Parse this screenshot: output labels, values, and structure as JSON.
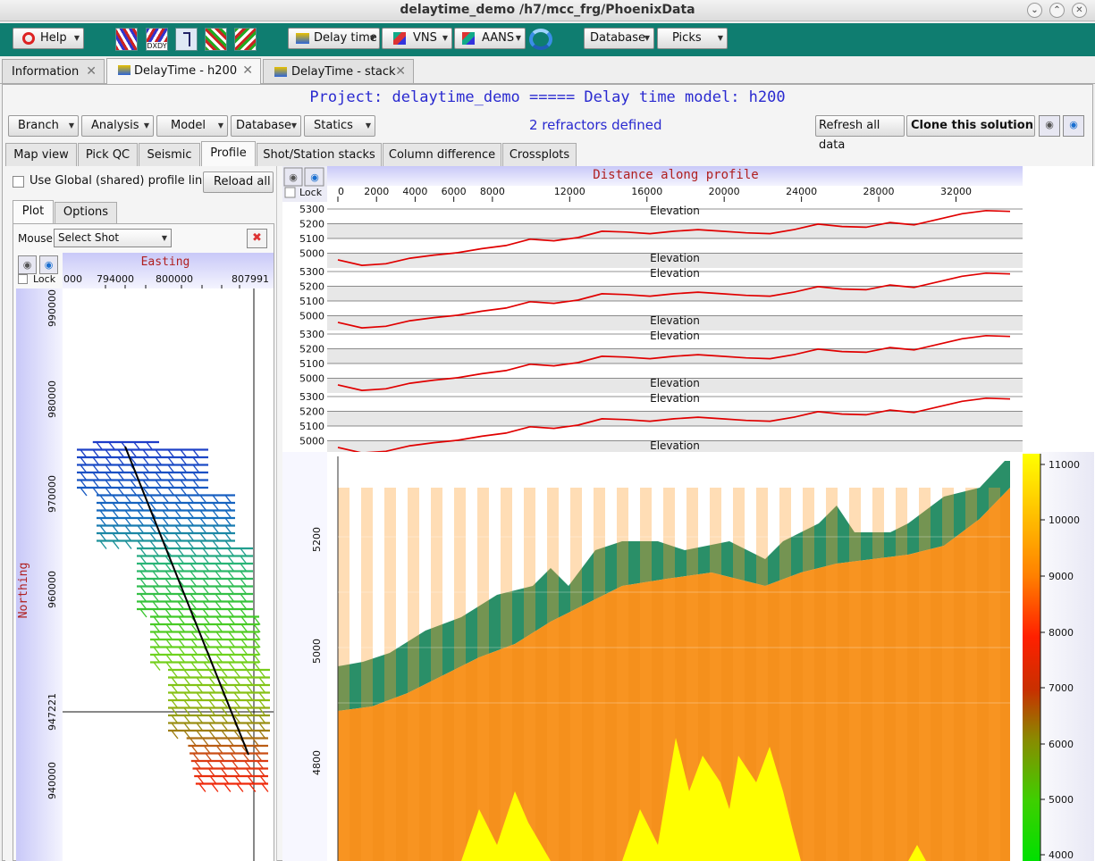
{
  "window": {
    "title": "delaytime_demo     /h7/mcc_frg/PhoenixData",
    "btn_min": "⌄",
    "btn_max": "⌃",
    "btn_close": "✕"
  },
  "toolbar": {
    "help": "Help",
    "delay_time": "Delay time",
    "vns": "VNS",
    "aans": "AANS",
    "database": "Database",
    "picks": "Picks",
    "dxdy": "DXDY"
  },
  "tabs": [
    {
      "label": "Information"
    },
    {
      "label": "DelayTime - h200"
    },
    {
      "label": "DelayTime - stack"
    }
  ],
  "tab_close": "✕",
  "project_title": "Project: delaytime_demo ===== Delay time model: h200",
  "menus": {
    "branch": "Branch",
    "analysis": "Analysis",
    "model": "Model",
    "database": "Database",
    "statics": "Statics"
  },
  "refractors": "2 refractors defined",
  "refresh": "Refresh all data",
  "clone": "Clone this solution",
  "subtabs": [
    "Map view",
    "Pick QC",
    "Seismic",
    "Profile",
    "Shot/Station stacks",
    "Column difference",
    "Crossplots"
  ],
  "left": {
    "use_global": "Use Global (shared) profile line",
    "reload": "Reload all",
    "tab_plot": "Plot",
    "tab_options": "Options",
    "mouse_label": "Mouse",
    "mouse_value": "Select Shot",
    "lock": "Lock",
    "map_title": "Easting",
    "y_label": "Northing",
    "x_ticks": [
      "000",
      "794000",
      "800000",
      "807991"
    ],
    "y_ticks": [
      "990000",
      "980000",
      "970000",
      "960000",
      "947221",
      "940000"
    ]
  },
  "right": {
    "lock": "Lock",
    "profile_title": "Distance along profile",
    "x_ticks": [
      "0",
      "2000",
      "4000",
      "6000",
      "8000",
      "12000",
      "16000",
      "20000",
      "24000",
      "28000",
      "32000"
    ],
    "track_label": "Elevation",
    "track_yticks": [
      "5300",
      "5200",
      "5100",
      "5000"
    ],
    "section_yticks": [
      "5200",
      "5000",
      "4800"
    ],
    "colorbar_ticks": [
      "11000",
      "10000",
      "9000",
      "8000",
      "7000",
      "6000",
      "5000",
      "4000"
    ]
  },
  "colors": {
    "accent": "#0f7d70",
    "title_blue": "#2a2ad0",
    "trace_red": "#e00000"
  }
}
